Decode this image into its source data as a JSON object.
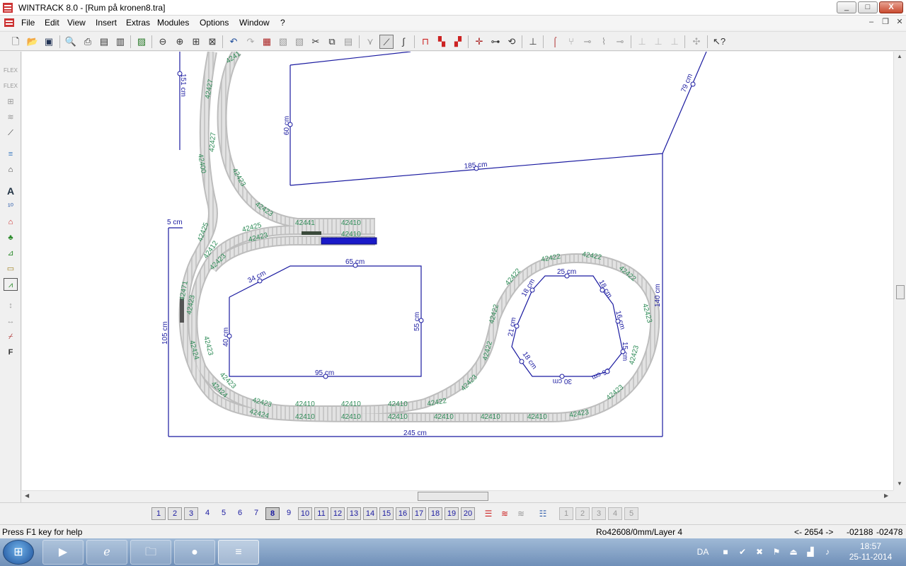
{
  "window": {
    "title": "WINTRACK 8.0 - [Rum på kronen8.tra]"
  },
  "window_controls": {
    "minimize": "_",
    "maximize": "□",
    "close": "X"
  },
  "mdi_controls": {
    "minimize": "–",
    "restore": "❐",
    "close": "✕"
  },
  "menu": [
    "File",
    "Edit",
    "View",
    "Insert",
    "Extras",
    "Modules",
    "Options",
    "Window",
    "?"
  ],
  "drawing": {
    "line_color": "#1a1aa0",
    "track_label_color": "#2e8b57",
    "dimensions": [
      {
        "name": "dim-151cm",
        "text": "151 cm"
      },
      {
        "name": "dim-60cm",
        "text": "60 cm"
      },
      {
        "name": "dim-185cm",
        "text": "185 cm"
      },
      {
        "name": "dim-79cm",
        "text": "79 cm"
      },
      {
        "name": "dim-5cm",
        "text": "5 cm"
      },
      {
        "name": "dim-105cm",
        "text": "105 cm"
      },
      {
        "name": "dim-34cm",
        "text": "34 cm"
      },
      {
        "name": "dim-65cm",
        "text": "65 cm"
      },
      {
        "name": "dim-55cm",
        "text": "55 cm"
      },
      {
        "name": "dim-40cm",
        "text": "40 cm"
      },
      {
        "name": "dim-95cm",
        "text": "95 cm"
      },
      {
        "name": "dim-245cm",
        "text": "245 cm"
      },
      {
        "name": "dim-140cm",
        "text": "140 cm"
      },
      {
        "name": "dim-25cm",
        "text": "25 cm"
      },
      {
        "name": "dim-18cm-top-left",
        "text": "18 cm"
      },
      {
        "name": "dim-18cm-top-right",
        "text": "18 cm"
      },
      {
        "name": "dim-16cm",
        "text": "16 cm"
      },
      {
        "name": "dim-21cm",
        "text": "21 cm"
      },
      {
        "name": "dim-15cm",
        "text": "15 cm"
      },
      {
        "name": "dim-18cm-bottom-left",
        "text": "18 cm"
      },
      {
        "name": "dim-16cm-bottom-right",
        "text": "16 cm"
      },
      {
        "name": "dim-30cm",
        "text": "30 cm"
      }
    ],
    "track_labels": [
      {
        "name": "track-42411-top",
        "text": "4241"
      },
      {
        "name": "track-42427-a",
        "text": "42427"
      },
      {
        "name": "track-42427-b",
        "text": "42427"
      },
      {
        "name": "track-42400",
        "text": "42400"
      },
      {
        "name": "track-42423-a",
        "text": "42423"
      },
      {
        "name": "track-42423-b",
        "text": "42423"
      },
      {
        "name": "track-42441",
        "text": "42441"
      },
      {
        "name": "track-42410-a",
        "text": "42410"
      },
      {
        "name": "track-42410-b",
        "text": "42410"
      },
      {
        "name": "track-42425-a",
        "text": "42425"
      },
      {
        "name": "track-42423-c",
        "text": "42423"
      },
      {
        "name": "track-42425-b",
        "text": "42425"
      },
      {
        "name": "track-42412",
        "text": "42412"
      },
      {
        "name": "track-42423-d",
        "text": "42423"
      },
      {
        "name": "track-42471",
        "text": "42471"
      },
      {
        "name": "track-42423-e",
        "text": "42423"
      },
      {
        "name": "track-42424-a",
        "text": "42424"
      },
      {
        "name": "track-42423-f",
        "text": "42423"
      },
      {
        "name": "track-42423-g",
        "text": "42423"
      },
      {
        "name": "track-42424-b",
        "text": "42424"
      },
      {
        "name": "track-42423-h",
        "text": "42423"
      },
      {
        "name": "track-42424-c",
        "text": "42424"
      },
      {
        "name": "track-42410-c",
        "text": "42410"
      },
      {
        "name": "track-42410-d",
        "text": "42410"
      },
      {
        "name": "track-42410-e",
        "text": "42410"
      },
      {
        "name": "track-42422-a",
        "text": "42422"
      },
      {
        "name": "track-42410-f",
        "text": "42410"
      },
      {
        "name": "track-42410-g",
        "text": "42410"
      },
      {
        "name": "track-42410-h",
        "text": "42410"
      },
      {
        "name": "track-42410-i",
        "text": "42410"
      },
      {
        "name": "track-42410-j",
        "text": "42410"
      },
      {
        "name": "track-42410-k",
        "text": "42410"
      },
      {
        "name": "track-42423-i",
        "text": "42423"
      },
      {
        "name": "track-42423-j",
        "text": "42423"
      },
      {
        "name": "track-42422-b",
        "text": "42422"
      },
      {
        "name": "track-42422-c",
        "text": "42422"
      },
      {
        "name": "track-42422-d",
        "text": "42422"
      },
      {
        "name": "track-42422-e",
        "text": "42422"
      },
      {
        "name": "track-42422-f",
        "text": "42422"
      },
      {
        "name": "track-42422-g",
        "text": "42422"
      },
      {
        "name": "track-42423-k",
        "text": "42423"
      },
      {
        "name": "track-42423-l",
        "text": "42423"
      },
      {
        "name": "track-42423-m",
        "text": "42423"
      },
      {
        "name": "track-42423-n",
        "text": "42423"
      }
    ]
  },
  "layers": [
    "1",
    "2",
    "3",
    "4",
    "5",
    "6",
    "7",
    "8",
    "9",
    "10",
    "11",
    "12",
    "13",
    "14",
    "15",
    "16",
    "17",
    "18",
    "19",
    "20"
  ],
  "active_layer": "8",
  "modules": [
    "1",
    "2",
    "3",
    "4",
    "5"
  ],
  "status": {
    "help": "Press F1 key for help",
    "item": "Ro42608/0mm/Layer 4",
    "distance": "<- 2654 ->",
    "x": "-02188",
    "y": "-02478"
  },
  "taskbar": {
    "lang": "DA",
    "time": "18:57",
    "date": "25-11-2014"
  }
}
